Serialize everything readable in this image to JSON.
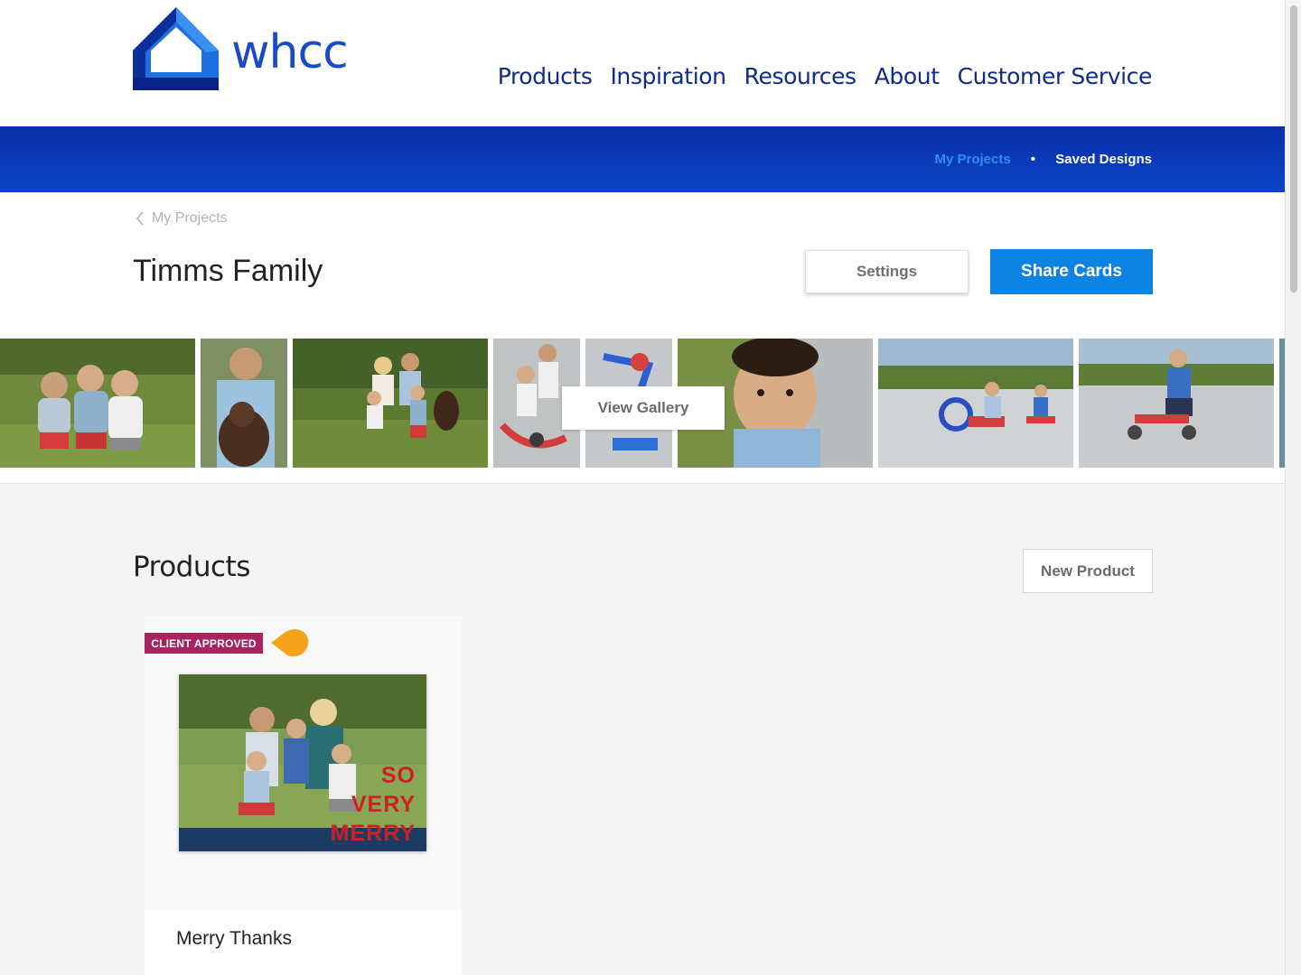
{
  "brand": {
    "logo_text": "whcc",
    "logo_icon": "house-logo-icon"
  },
  "main_nav": [
    {
      "label": "Products"
    },
    {
      "label": "Inspiration"
    },
    {
      "label": "Resources"
    },
    {
      "label": "About"
    },
    {
      "label": "Customer Service"
    }
  ],
  "sub_nav": {
    "active": "My Projects",
    "separator": "•",
    "link": "Saved Designs"
  },
  "breadcrumb": {
    "label": "My Projects",
    "icon": "chevron-left-icon"
  },
  "project": {
    "title": "Timms Family"
  },
  "actions": {
    "settings": "Settings",
    "share": "Share Cards"
  },
  "gallery": {
    "button": "View Gallery",
    "photo_count_visible": 9
  },
  "products": {
    "title": "Products",
    "new_button": "New Product",
    "cards": [
      {
        "title": "Merry Thanks",
        "badge": "CLIENT APPROVED",
        "card_text": [
          "SO",
          "VERY",
          "MERRY"
        ]
      }
    ]
  },
  "colors": {
    "brand_blue": "#0a2fa8",
    "nav_text": "#0e2a8a",
    "accent_button": "#0d83e3",
    "badge": "#a8245e",
    "pin": "#f5a21b",
    "sub_active": "#2d8ff2"
  }
}
